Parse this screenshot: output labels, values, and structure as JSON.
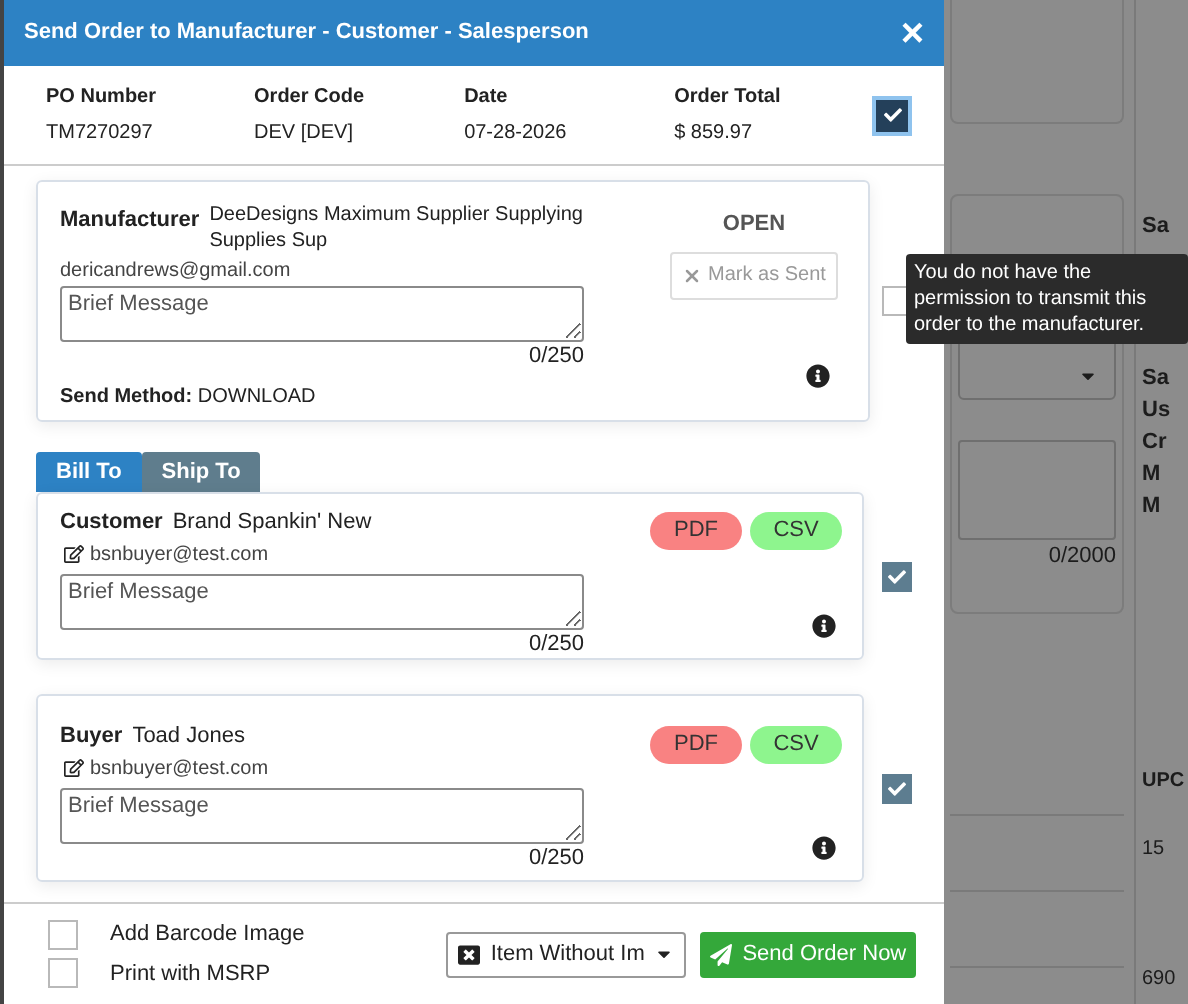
{
  "dialog": {
    "title": "Send Order to Manufacturer - Customer - Salesperson",
    "close": "×"
  },
  "summary": {
    "fields": [
      {
        "label": "PO Number",
        "value": "TM7270297"
      },
      {
        "label": "Order Code",
        "value": "DEV [DEV]"
      },
      {
        "label": "Date",
        "value": "07-28-2026"
      },
      {
        "label": "Order Total",
        "value": "$ 859.97"
      }
    ],
    "checked": true
  },
  "manufacturer": {
    "label": "Manufacturer",
    "name": "DeeDesigns Maximum Supplier Supplying Supplies Sup",
    "email": "dericandrews@gmail.com",
    "message": {
      "placeholder": "Brief Message",
      "counter": "0/250"
    },
    "send_method_label": "Send Method:",
    "send_method": "DOWNLOAD",
    "status": "OPEN",
    "mark_button": "Mark as Sent",
    "mark_disabled": true,
    "checked": false,
    "tooltip": "You do not have the permission to transmit this order to the manufacturer."
  },
  "tabs": [
    {
      "label": "Bill To",
      "selected": true
    },
    {
      "label": "Ship To",
      "selected": false
    }
  ],
  "recipients": [
    {
      "label": "Customer",
      "name": "Brand Spankin' New",
      "email": "bsnbuyer@test.com",
      "message": {
        "placeholder": "Brief Message",
        "counter": "0/250"
      },
      "buttons": [
        {
          "label": "PDF",
          "color": "#f98282"
        },
        {
          "label": "CSV",
          "color": "#8ef58e"
        }
      ],
      "checked": true
    },
    {
      "label": "Buyer",
      "name": "Toad Jones",
      "email": "bsnbuyer@test.com",
      "message": {
        "placeholder": "Brief Message",
        "counter": "0/250"
      },
      "buttons": [
        {
          "label": "PDF",
          "color": "#f98282"
        },
        {
          "label": "CSV",
          "color": "#8ef58e"
        }
      ],
      "checked": true
    }
  ],
  "footer": {
    "options": [
      {
        "label": "Add Barcode Image",
        "checked": false
      },
      {
        "label": "Print with MSRP",
        "checked": false
      }
    ],
    "image_select": "Item Without Im",
    "send_button": "Send Order Now"
  },
  "background": {
    "form_labels": [
      "Sa",
      "Sa",
      "Us",
      "Cr",
      "M",
      "M"
    ],
    "counter": "0/2000",
    "table_header": "UPC",
    "table_cells": [
      "15",
      "690"
    ]
  }
}
